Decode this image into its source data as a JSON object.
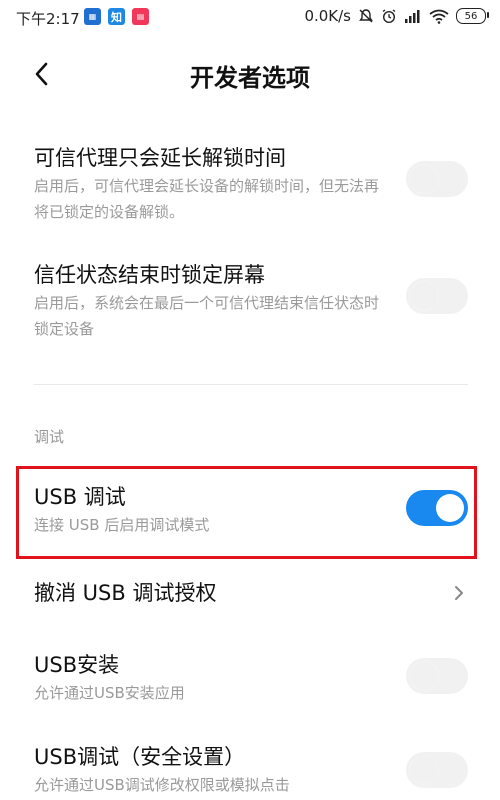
{
  "status_bar": {
    "time": "下午2:17",
    "network_speed": "0.0K/s",
    "battery": "56",
    "app_icons": [
      "app-icon-1",
      "zhihu-icon",
      "app-icon-3"
    ],
    "app2_label": "知"
  },
  "header": {
    "title": "开发者选项"
  },
  "settings": {
    "trust_agent_extend": {
      "title": "可信代理只会延长解锁时间",
      "desc": "启用后，可信代理会延长设备的解锁时间，但无法再将已锁定的设备解锁。",
      "enabled": false
    },
    "lock_on_trust_lost": {
      "title": "信任状态结束时锁定屏幕",
      "desc": "启用后，系统会在最后一个可信代理结束信任状态时锁定设备",
      "enabled": false
    },
    "section_debug": "调试",
    "usb_debugging": {
      "title": "USB 调试",
      "desc": "连接 USB 后启用调试模式",
      "enabled": true
    },
    "revoke_usb_auth": {
      "title": "撤消 USB 调试授权"
    },
    "usb_install": {
      "title": "USB安装",
      "desc": "允许通过USB安装应用",
      "enabled": false
    },
    "usb_debug_security": {
      "title": "USB调试（安全设置）",
      "desc": "允许通过USB调试修改权限或模拟点击",
      "enabled": false
    }
  },
  "colors": {
    "toggle_on": "#1989ef",
    "highlight": "#e0121b"
  }
}
